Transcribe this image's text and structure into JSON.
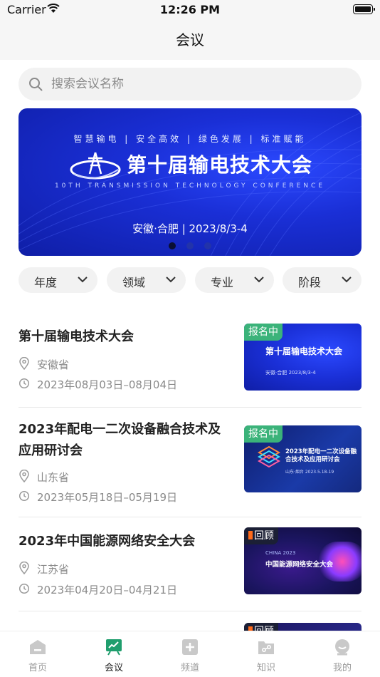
{
  "status": {
    "carrier": "Carrier",
    "time": "12:26 PM"
  },
  "nav": {
    "title": "会议"
  },
  "search": {
    "placeholder": "搜索会议名称"
  },
  "banner": {
    "slogan": "智慧输电 | 安全高效 | 绿色发展 | 标准赋能",
    "title": "第十届输电技术大会",
    "subtitle": "10TH TRANSMISSION TECHNOLOGY CONFERENCE",
    "location_date": "安徽·合肥 | 2023/8/3-4",
    "dots": 3,
    "active_dot": 0
  },
  "filters": [
    {
      "label": "年度"
    },
    {
      "label": "领域"
    },
    {
      "label": "专业"
    },
    {
      "label": "阶段"
    }
  ],
  "conferences": [
    {
      "title": "第十届输电技术大会",
      "province": "安徽省",
      "dates": "2023年08月03日–08月04日",
      "badge": "报名中",
      "thumb_title": "第十届输电技术大会",
      "thumb_sub": "安徽·合肥 2023/8/3-4"
    },
    {
      "title": "2023年配电一二次设备融合技术及应用研讨会",
      "province": "山东省",
      "dates": "2023年05月18日–05月19日",
      "badge": "报名中",
      "thumb_title": "2023年配电一二次设备融合技术及应用研讨会",
      "thumb_sub": "山东·烟台 2023.5.18-19"
    },
    {
      "title": "2023年中国能源网络安全大会",
      "province": "江苏省",
      "dates": "2023年04月20日–04月21日",
      "badge": "回顾",
      "thumb_title": "中国能源网络安全大会",
      "thumb_sub": "CHINA 2023"
    },
    {
      "badge": "回顾"
    }
  ],
  "tabs": [
    {
      "label": "首页",
      "icon": "home-icon"
    },
    {
      "label": "会议",
      "icon": "meeting-icon"
    },
    {
      "label": "频道",
      "icon": "channel-icon"
    },
    {
      "label": "知识",
      "icon": "knowledge-icon"
    },
    {
      "label": "我的",
      "icon": "profile-icon"
    }
  ],
  "colors": {
    "accent_green": "#3bb37a",
    "banner_blue": "#1a2fd6",
    "review_orange": "#ff6a1a"
  }
}
